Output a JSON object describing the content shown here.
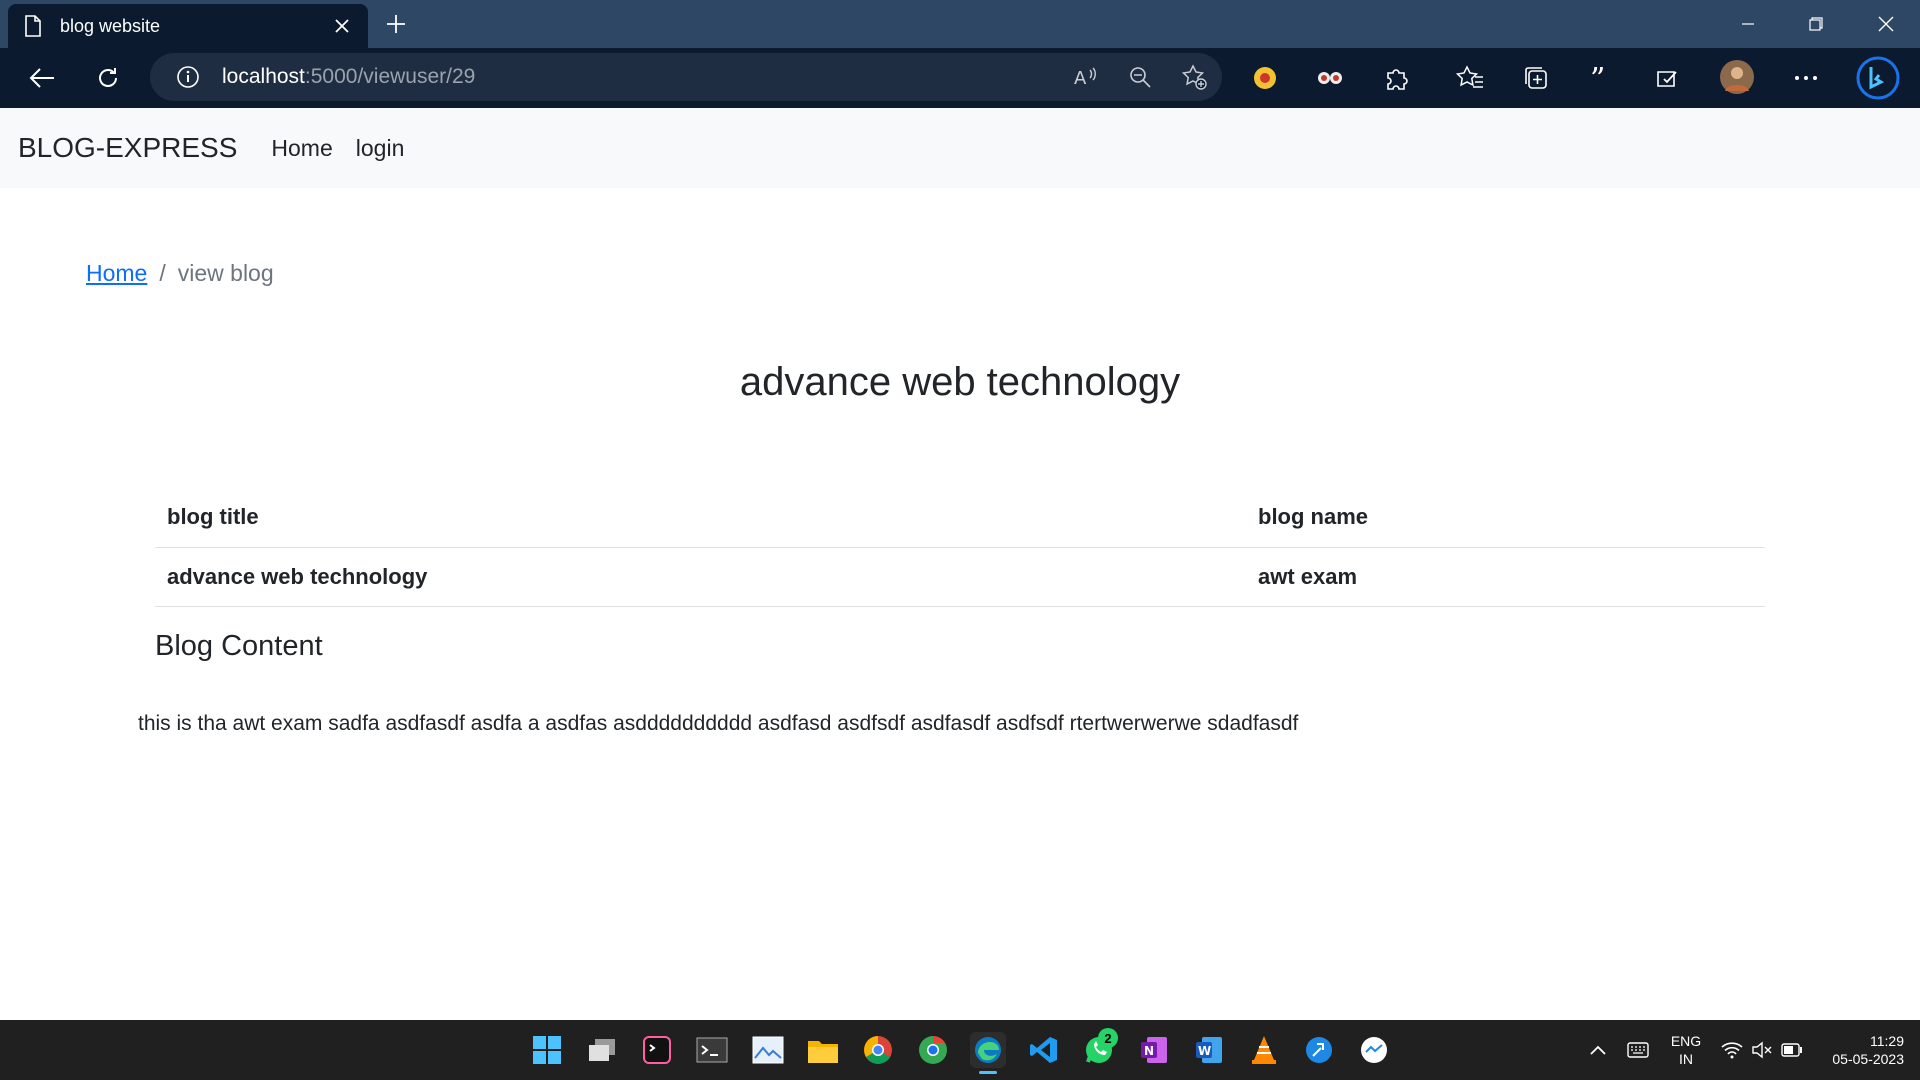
{
  "browser": {
    "tab_title": "blog website",
    "address_host": "localhost",
    "address_path": ":5000/viewuser/29"
  },
  "app": {
    "brand": "BLOG-EXPRESS",
    "nav": {
      "home": "Home",
      "login": "login"
    }
  },
  "breadcrumb": {
    "home": "Home",
    "separator": "/",
    "current": "view blog"
  },
  "blog": {
    "heading": "advance web technology",
    "table": {
      "header_title": "blog title",
      "header_name": "blog name",
      "row_title": "advance web technology",
      "row_name": "awt exam"
    },
    "content_heading": "Blog Content",
    "content_text": "this is tha awt exam sadfa asdfasdf asdfa a asdfas asdddddddddd asdfasd asdfsdf asdfasdf asdfsdf rtertwerwerwe sdadfasdf"
  },
  "taskbar": {
    "whatsapp_badge": "2",
    "lang_line1": "ENG",
    "lang_line2": "IN",
    "time": "11:29",
    "date": "05-05-2023"
  },
  "colors": {
    "title_bar": "#2e4765",
    "toolbar": "#0b1a2e",
    "link": "#0d6efd",
    "navbar_bg": "#f8f9fa",
    "taskbar": "#202020"
  }
}
